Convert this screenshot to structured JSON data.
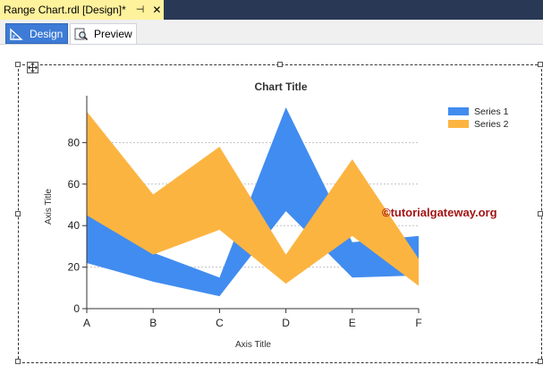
{
  "document_tab": {
    "title": "Range Chart.rdl [Design]*",
    "pin_glyph": "⊣",
    "close_glyph": "✕"
  },
  "view_tabs": [
    {
      "label": "Design",
      "icon": "design-ruler-icon",
      "active": true
    },
    {
      "label": "Preview",
      "icon": "preview-magnifier-icon",
      "active": false
    }
  ],
  "watermark": "©tutorialgateway.org",
  "colors": {
    "series1": "#418cf0",
    "series2": "#fcb441",
    "tab_active": "#3d7bd6",
    "doc_tab": "#fff29d",
    "watermark": "#a31515"
  },
  "chart_data": {
    "type": "area",
    "subtype": "range",
    "title": "Chart Title",
    "xlabel": "Axis Title",
    "ylabel": "Axis Title",
    "categories": [
      "A",
      "B",
      "C",
      "D",
      "E",
      "F"
    ],
    "ylim": [
      0,
      100
    ],
    "yticks": [
      0,
      20,
      40,
      60,
      80
    ],
    "grid": true,
    "legend_position": "top-right",
    "series": [
      {
        "name": "Series 1",
        "low": [
          22,
          13,
          6,
          47,
          15,
          16
        ],
        "high": [
          46,
          27,
          15,
          97,
          32,
          35
        ]
      },
      {
        "name": "Series 2",
        "low": [
          45,
          26,
          38,
          12,
          35,
          11
        ],
        "high": [
          95,
          55,
          78,
          26,
          72,
          24
        ]
      }
    ]
  }
}
